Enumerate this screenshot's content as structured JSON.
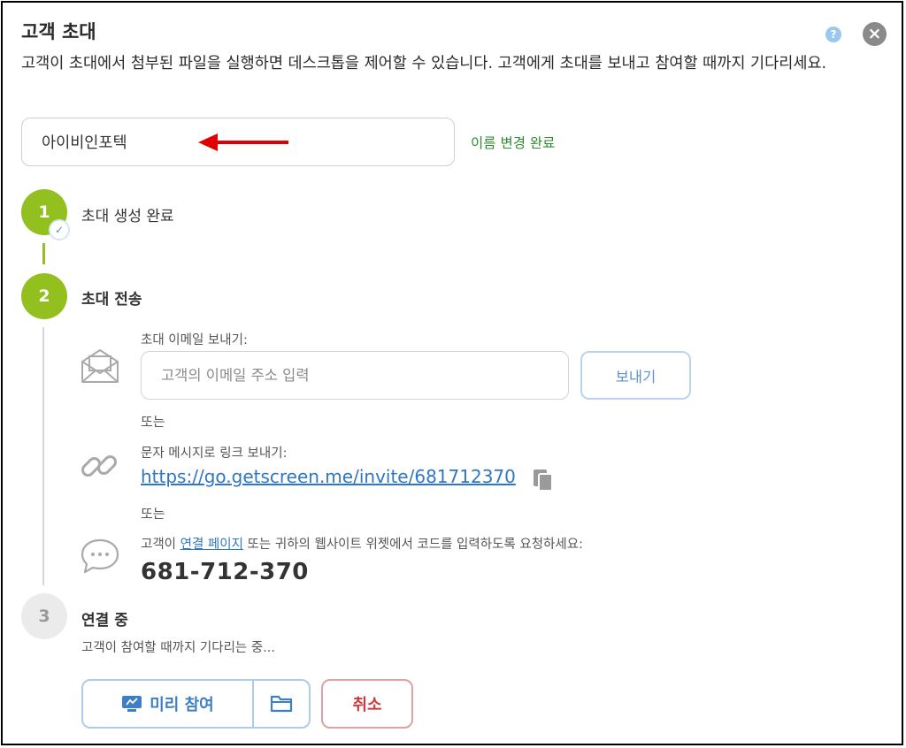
{
  "dialog": {
    "title": "고객 초대",
    "description": "고객이 초대에서 첨부된 파일을 실행하면 데스크톱을 제어할 수 있습니다. 고객에게 초대를 보내고 참여할 때까지 기다리세요."
  },
  "name_field": {
    "value": "아이비인포텍",
    "status": "이름 변경 완료"
  },
  "steps": [
    {
      "number": "1",
      "label": "초대 생성 완료"
    },
    {
      "number": "2",
      "label": "초대 전송"
    },
    {
      "number": "3",
      "label": "연결 중"
    }
  ],
  "email": {
    "label": "초대 이메일 보내기:",
    "placeholder": "고객의 이메일 주소 입력",
    "send_label": "보내기"
  },
  "or_text": "또는",
  "sms": {
    "label": "문자 메시지로 링크 보내기:",
    "link": "https://go.getscreen.me/invite/681712370"
  },
  "code": {
    "text_prefix": "고객이 ",
    "link_text": "연결 페이지",
    "text_suffix": " 또는 귀하의 웹사이트 위젯에서 코드를 입력하도록 요청하세요:",
    "value": "681-712-370"
  },
  "connecting": {
    "waiting_text": "고객이 참여할 때까지 기다리는 중..."
  },
  "buttons": {
    "join_label": "미리 참여",
    "cancel_label": "취소"
  },
  "colors": {
    "step_active": "#93c01f",
    "link": "#2f77c6",
    "success": "#2d8a2d",
    "cancel": "#d23b3b",
    "annotation_arrow": "#e00000"
  },
  "icons": [
    "help-icon",
    "close-icon",
    "check-icon",
    "envelope-icon",
    "link-icon",
    "copy-icon",
    "chat-icon",
    "screen-icon",
    "folder-icon"
  ]
}
